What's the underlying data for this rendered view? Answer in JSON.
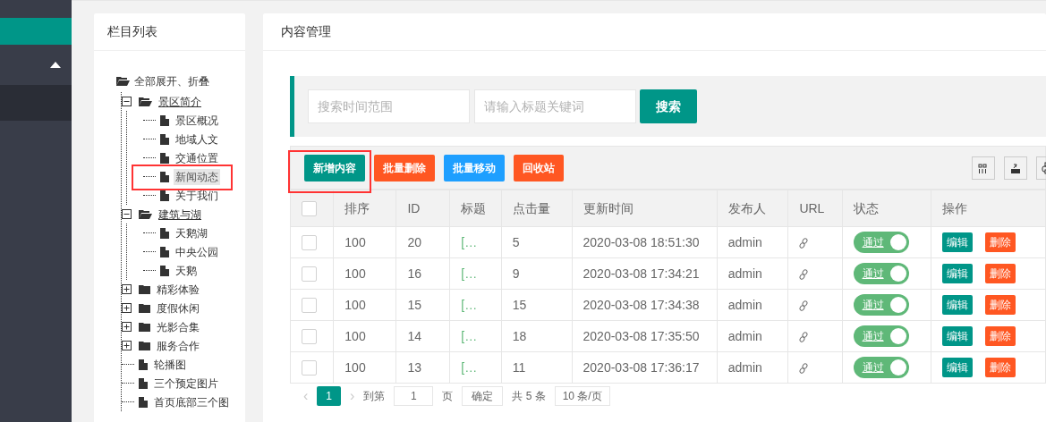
{
  "tree_panel": {
    "title": "栏目列表",
    "toggle_all": "全部展开、折叠",
    "nodes": [
      {
        "label": "景区简介",
        "kind": "folder",
        "expanded": true,
        "selected": false,
        "children": [
          {
            "label": "景区概况",
            "kind": "page",
            "selected": false
          },
          {
            "label": "地域人文",
            "kind": "page",
            "selected": false
          },
          {
            "label": "交通位置",
            "kind": "page",
            "selected": false
          },
          {
            "label": "新闻动态",
            "kind": "page",
            "selected": true
          },
          {
            "label": "关于我们",
            "kind": "page",
            "selected": false
          }
        ]
      },
      {
        "label": "建筑与湖",
        "kind": "folder",
        "expanded": true,
        "selected": false,
        "children": [
          {
            "label": "天鹅湖",
            "kind": "page",
            "selected": false
          },
          {
            "label": "中央公园",
            "kind": "page",
            "selected": false
          },
          {
            "label": "天鹅",
            "kind": "page",
            "selected": false
          }
        ]
      },
      {
        "label": "精彩体验",
        "kind": "folder",
        "expanded": false,
        "selected": false
      },
      {
        "label": "度假休闲",
        "kind": "folder",
        "expanded": false,
        "selected": false
      },
      {
        "label": "光影合集",
        "kind": "folder",
        "expanded": false,
        "selected": false
      },
      {
        "label": "服务合作",
        "kind": "folder",
        "expanded": false,
        "selected": false
      },
      {
        "label": "轮播图",
        "kind": "page",
        "selected": false
      },
      {
        "label": "三个预定图片",
        "kind": "page",
        "selected": false
      },
      {
        "label": "首页底部三个图",
        "kind": "page",
        "selected": false
      }
    ]
  },
  "content_panel": {
    "title": "内容管理",
    "search": {
      "fields": [
        {
          "placeholder": "搜索时间范围"
        },
        {
          "placeholder": "请输入标题关键词"
        }
      ],
      "button": "搜索"
    },
    "actions": [
      {
        "label": "新增内容",
        "kind": "primary"
      },
      {
        "label": "批量删除",
        "kind": "danger"
      },
      {
        "label": "批量移动",
        "kind": "info"
      },
      {
        "label": "回收站",
        "kind": "danger"
      }
    ],
    "table": {
      "all_checked": false,
      "columns": [
        "排序",
        "ID",
        "标题",
        "点击量",
        "更新时间",
        "发布人",
        "URL",
        "状态",
        "操作"
      ],
      "rows": [
        {
          "checked": false,
          "order": "100",
          "id": "20",
          "title": "[…",
          "hits": "5",
          "updated": "2020-03-08 18:51:30",
          "author": "admin",
          "status": {
            "label": "通过",
            "on": true
          },
          "edit": "编辑",
          "delete": "删除"
        },
        {
          "checked": false,
          "order": "100",
          "id": "16",
          "title": "[…",
          "hits": "9",
          "updated": "2020-03-08 17:34:21",
          "author": "admin",
          "status": {
            "label": "通过",
            "on": true
          },
          "edit": "编辑",
          "delete": "删除"
        },
        {
          "checked": false,
          "order": "100",
          "id": "15",
          "title": "[…",
          "hits": "15",
          "updated": "2020-03-08 17:34:38",
          "author": "admin",
          "status": {
            "label": "通过",
            "on": true
          },
          "edit": "编辑",
          "delete": "删除"
        },
        {
          "checked": false,
          "order": "100",
          "id": "14",
          "title": "[…",
          "hits": "18",
          "updated": "2020-03-08 17:35:50",
          "author": "admin",
          "status": {
            "label": "通过",
            "on": true
          },
          "edit": "编辑",
          "delete": "删除"
        },
        {
          "checked": false,
          "order": "100",
          "id": "13",
          "title": "[…",
          "hits": "11",
          "updated": "2020-03-08 17:36:17",
          "author": "admin",
          "status": {
            "label": "通过",
            "on": true
          },
          "edit": "编辑",
          "delete": "删除"
        }
      ]
    },
    "pagination": {
      "prev": "‹",
      "next": "›",
      "pages": [
        {
          "label": "1",
          "selected": true
        }
      ],
      "goto_label": "到第",
      "goto_value": "1",
      "page_unit": "页",
      "confirm": "确定",
      "total": "共 5 条",
      "page_size": "10 条/页"
    }
  }
}
